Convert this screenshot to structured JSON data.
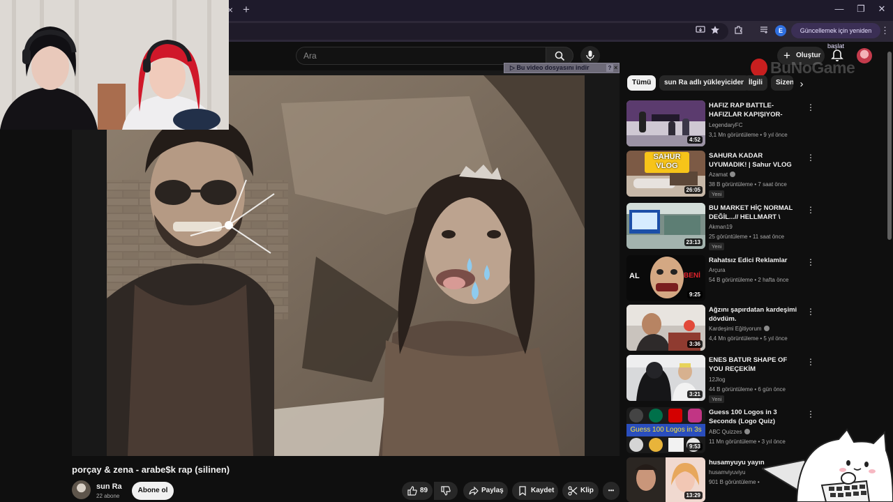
{
  "browser": {
    "tab_close": "×",
    "tab_new": "+",
    "minimize": "—",
    "restore": "❐",
    "close": "✕",
    "profile_initial": "E",
    "update_label": "Güncellemek için yeniden başlat",
    "menu": "⋮"
  },
  "masthead": {
    "search_placeholder": "Ara",
    "create_label": "Oluştur",
    "create_plus": "+"
  },
  "watermark": {
    "text": "BuNoGame"
  },
  "player": {
    "download_banner": "▷ Bu video dosyasını indir",
    "download_help": "?",
    "download_close": "×"
  },
  "video": {
    "title": "porçay & zena - arabe$k rap (silinen)",
    "channel": "sun Ra",
    "subscribers": "22 abone",
    "subscribe_label": "Abone ol",
    "like_count": "89",
    "share_label": "Paylaş",
    "save_label": "Kaydet",
    "clip_label": "Klip",
    "more": "•••"
  },
  "chips": [
    "Tümü",
    "sun Ra adlı yükleyiciden",
    "İlgili",
    "Sizen"
  ],
  "recommendations": [
    {
      "title": "HAFIZ RAP BATTLE-HAFIZLAR KAPIŞIYOR-HAFIZ LAF ...",
      "channel": "LegendaryFC",
      "verified": false,
      "meta": "3,1 Mn görüntüleme • 9 yıl önce",
      "duration": "4:52",
      "badge": ""
    },
    {
      "title": "SAHURA KADAR UYUMADIK! | Sahur VLOG",
      "channel": "Azamat",
      "verified": true,
      "meta": "38 B görüntüleme • 7 saat önce",
      "duration": "26:05",
      "badge": "Yeni",
      "thumb_text": "SAHUR VLOG"
    },
    {
      "title": "BU MARKET HİÇ NORMAL DEĞİL...// HELLMART \\ BÖLÜ...",
      "channel": "Akman19",
      "verified": false,
      "meta": "25 görüntüleme • 11 saat önce",
      "duration": "23:13",
      "badge": "Yeni"
    },
    {
      "title": "Rahatsız Edici Reklamlar",
      "channel": "Arçura",
      "verified": false,
      "meta": "54 B görüntüleme • 2 hafta önce",
      "duration": "9:25",
      "badge": "",
      "thumb_left": "AL",
      "thumb_right": "BENİ"
    },
    {
      "title": "Ağzını şapırdatan kardeşimi dövdüm.",
      "channel": "Kardeşimi Eğitiyorum",
      "verified": true,
      "meta": "4,4 Mn görüntüleme • 5 yıl önce",
      "duration": "3:36",
      "badge": ""
    },
    {
      "title": "ENES BATUR SHAPE OF YOU REÇEKİM",
      "channel": "12Jlog",
      "verified": false,
      "meta": "44 B görüntüleme • 6 gün önce",
      "duration": "3:21",
      "badge": "Yeni"
    },
    {
      "title": "Guess 100 Logos in 3 Seconds (Logo Quiz)",
      "channel": "ABC Quizzes",
      "verified": true,
      "meta": "11 Mn görüntüleme • 3 yıl önce",
      "duration": "9:53",
      "badge": "",
      "thumb_text": "Guess 100 Logos in 3s"
    },
    {
      "title": "husamyuyu yayın",
      "channel": "husamviyuviyu",
      "verified": false,
      "meta": "901 B görüntüleme •",
      "duration": "13:29",
      "badge": ""
    }
  ],
  "colors": {
    "background": "#0f0f0f",
    "chip_active": "#f1f1f1",
    "update_pill": "#3b2f55",
    "browser_tabbar": "#1e1a2b"
  }
}
